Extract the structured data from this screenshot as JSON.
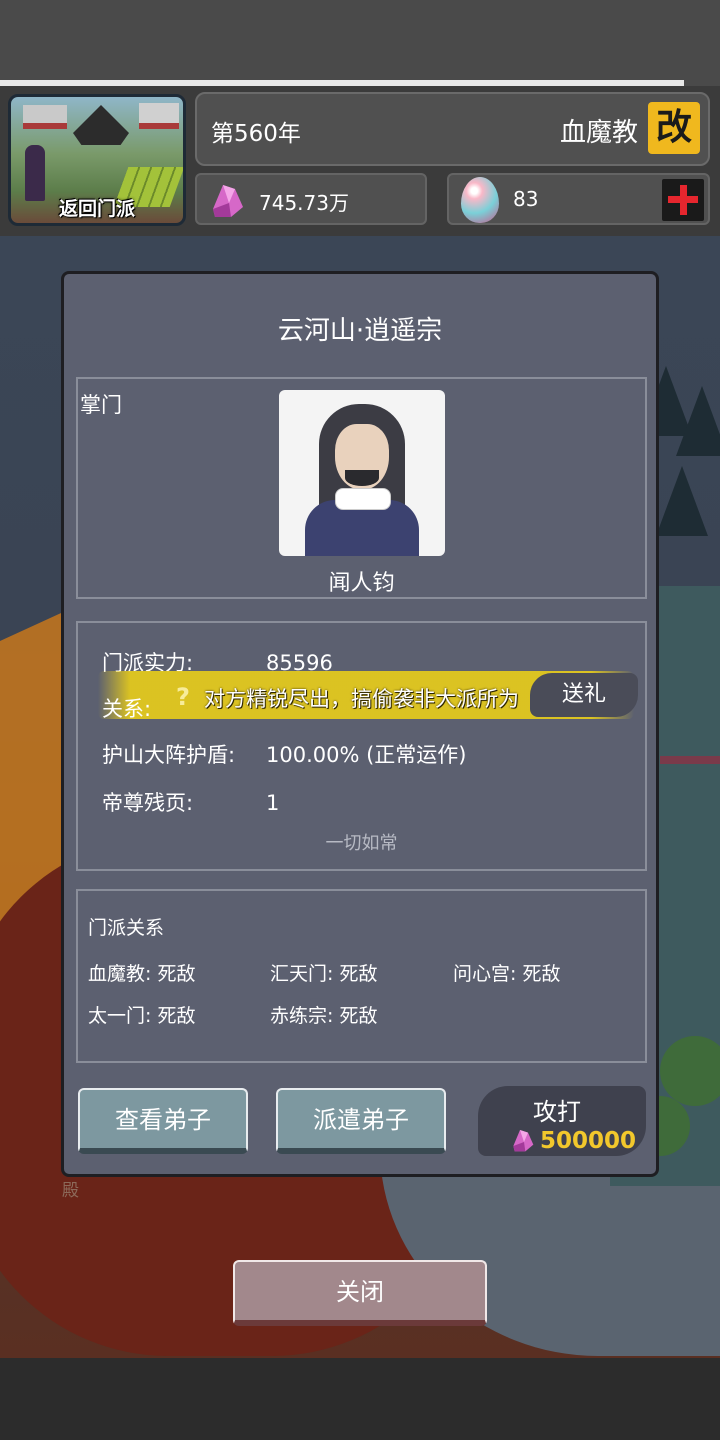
{
  "hud": {
    "home_label": "返回门派",
    "year": "第560年",
    "sect_name": "血魔教",
    "rename_label": "改",
    "spirit_stones": "745.73万",
    "eggs": "83"
  },
  "modal": {
    "title": "云河山·逍遥宗",
    "leader_label": "掌门",
    "leader_name": "闻人钧",
    "stats": {
      "power_label": "门派实力:",
      "power_value": "85596",
      "relation_label": "关系:",
      "relation_text": "对方精锐尽出，搞偷袭非大派所为",
      "gift_label": "送礼",
      "shield_label": "护山大阵护盾:",
      "shield_value": "100.00% (正常运作)",
      "pages_label": "帝尊残页:",
      "pages_value": "1",
      "status_note": "一切如常"
    },
    "relations": {
      "title": "门派关系",
      "items": [
        "血魔教: 死敌",
        "汇天门: 死敌",
        "问心宫: 死敌",
        "太一门: 死敌",
        "赤练宗: 死敌"
      ]
    },
    "buttons": {
      "view_disciples": "查看弟子",
      "send_disciples": "派遣弟子",
      "attack": "攻打",
      "attack_cost": "500000"
    }
  },
  "scene": {
    "hall_label": "殿"
  },
  "close_label": "关闭",
  "colors": {
    "accent_gold": "#f0b81e",
    "cost_yellow": "#f2c82c",
    "relation_glow": "#e2c81e",
    "plus_red": "#e6262e"
  },
  "icons": [
    "crystal-icon",
    "egg-icon",
    "plus-icon",
    "question-icon"
  ]
}
